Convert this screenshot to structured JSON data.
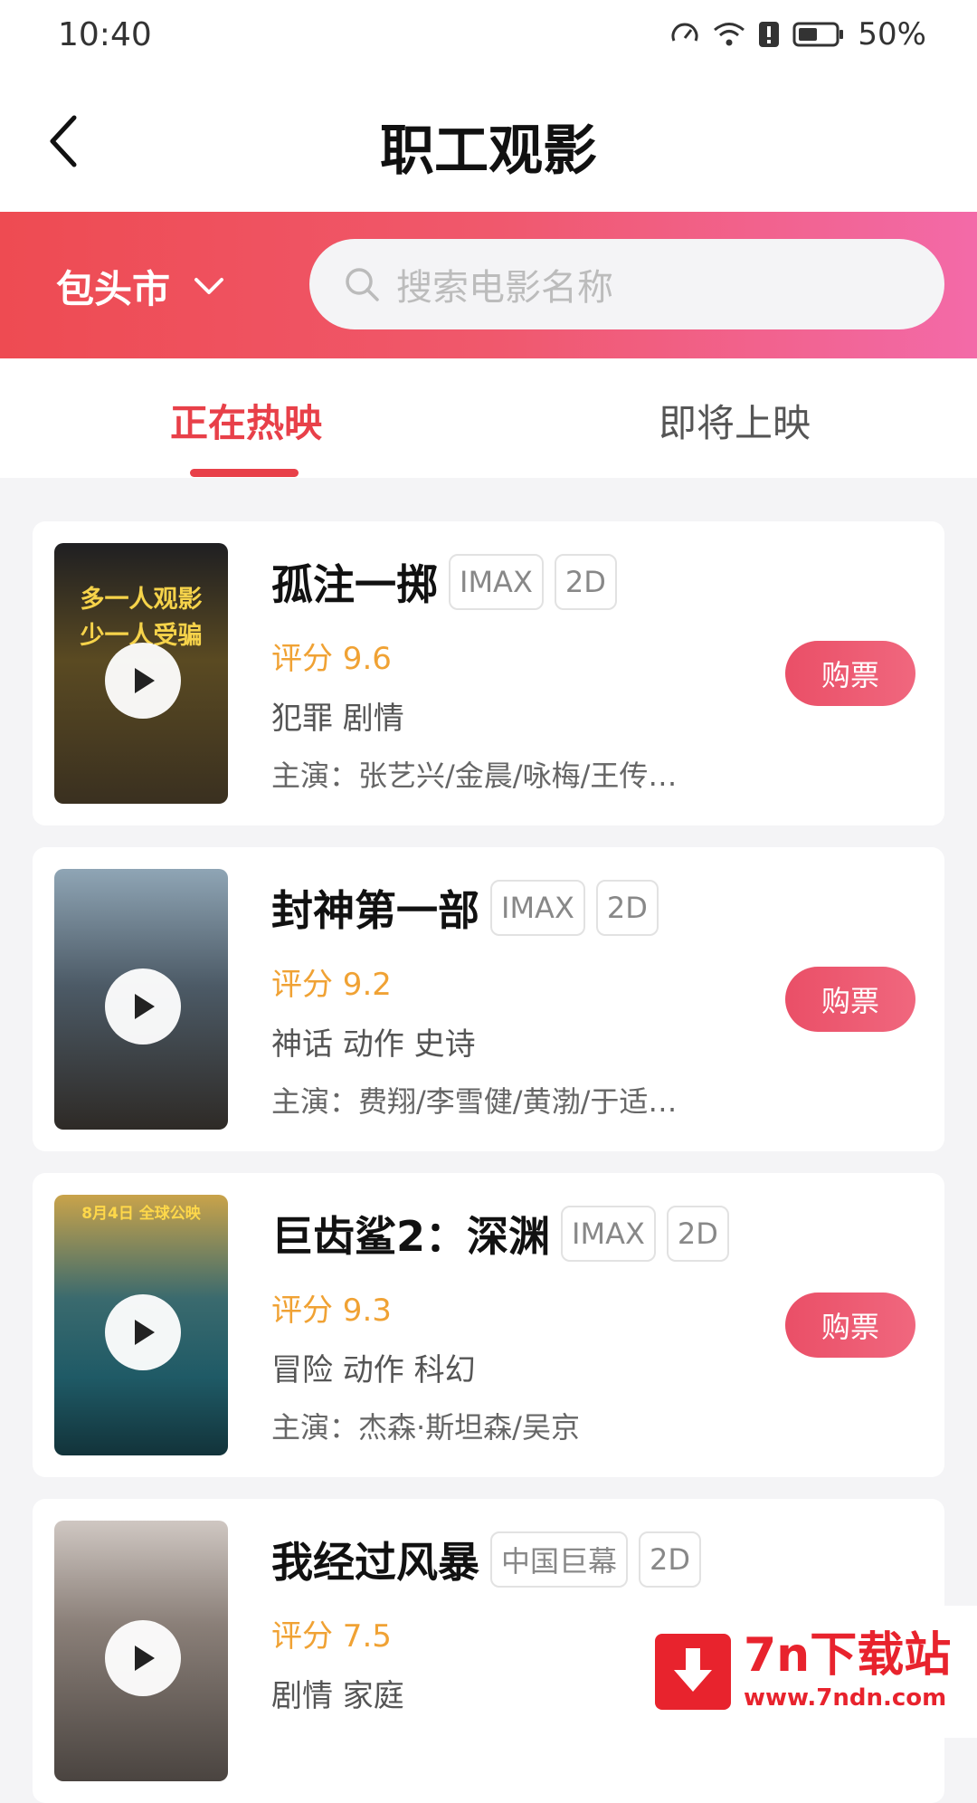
{
  "status_bar": {
    "time": "10:40",
    "battery": "50%"
  },
  "header": {
    "title": "职工观影"
  },
  "banner": {
    "city": "包头市",
    "search_placeholder": "搜索电影名称"
  },
  "tabs": [
    {
      "label": "正在热映",
      "active": true
    },
    {
      "label": "即将上映",
      "active": false
    }
  ],
  "movies": [
    {
      "title": "孤注一掷",
      "tags": [
        "IMAX",
        "2D"
      ],
      "score": "评分 9.6",
      "genres": "犯罪 剧情",
      "cast": "主演：张艺兴/金晨/咏梅/王传…",
      "buy_label": "购票",
      "poster_text_top": "多一人观影",
      "poster_text_bottom": "少一人受骗",
      "poster_color": "#5a4a22"
    },
    {
      "title": "封神第一部",
      "tags": [
        "IMAX",
        "2D"
      ],
      "score": "评分 9.2",
      "genres": "神话 动作 史诗",
      "cast": "主演：费翔/李雪健/黄渤/于适…",
      "buy_label": "购票",
      "poster_text_top": "",
      "poster_text_bottom": "",
      "poster_color": "#4c5a66"
    },
    {
      "title": "巨齿鲨2：深渊",
      "tags": [
        "IMAX",
        "2D"
      ],
      "score": "评分 9.3",
      "genres": "冒险 动作 科幻",
      "cast": "主演：杰森·斯坦森/吴京",
      "buy_label": "购票",
      "poster_text_top": "8月4日 全球公映",
      "poster_text_bottom": "",
      "poster_color": "#1f5a66"
    },
    {
      "title": "我经过风暴",
      "tags": [
        "中国巨幕",
        "2D"
      ],
      "score": "评分 7.5",
      "genres": "剧情 家庭",
      "cast": "",
      "buy_label": "",
      "poster_text_top": "",
      "poster_text_bottom": "",
      "poster_color": "#6a6462"
    }
  ],
  "watermark": {
    "title": "7n下载站",
    "url": "www.7ndn.com"
  },
  "colors": {
    "accent": "#e84049",
    "score": "#f0a234",
    "banner_start": "#ee4b52",
    "banner_end": "#f36aa8"
  }
}
